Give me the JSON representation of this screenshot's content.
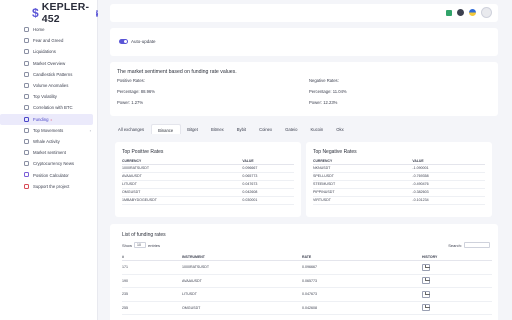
{
  "brand": {
    "name": "KEPLER-452",
    "colors": {
      "accent": "#5a55d6",
      "background": "#f4f5f9",
      "negative": "#e24b6a"
    }
  },
  "sidebar": {
    "items": [
      {
        "label": "Home",
        "icon": "home-icon"
      },
      {
        "label": "Fear and Greed",
        "icon": "gauge-icon"
      },
      {
        "label": "Liquidations",
        "icon": "drop-icon"
      },
      {
        "label": "Market Overview",
        "icon": "chart-icon"
      },
      {
        "label": "Candlestick Patterns",
        "icon": "candle-icon"
      },
      {
        "label": "Volume Anomalies",
        "icon": "wave-icon"
      },
      {
        "label": "Top Volatility",
        "icon": "target-icon"
      },
      {
        "label": "Correlation with BTC",
        "icon": "link-icon"
      },
      {
        "label": "Funding",
        "icon": "calendar-icon",
        "active": true,
        "badge": "•"
      },
      {
        "label": "Top Movements",
        "icon": "trend-icon",
        "arrow": "›"
      },
      {
        "label": "Whale Activity",
        "icon": "whale-icon"
      },
      {
        "label": "Market sentiment",
        "icon": "smile-icon"
      },
      {
        "label": "Cryptocurrency News",
        "icon": "news-icon"
      },
      {
        "label": "Position Calculator",
        "icon": "calculator-icon"
      },
      {
        "label": "Support the project",
        "icon": "heart-icon"
      }
    ]
  },
  "header": {
    "icons": [
      {
        "name": "flag-icon",
        "color": "#31a36a"
      },
      {
        "name": "theme-moon-icon",
        "color": "#3d4150"
      },
      {
        "name": "language-flag-icon",
        "color": "#2f6bd6"
      }
    ],
    "avatar": "avatar"
  },
  "autoupdate": {
    "label": "Auto-update",
    "enabled": true
  },
  "sentiment": {
    "title": "The market sentiment based on funding rate values.",
    "positive": {
      "title": "Positive Rates:",
      "percentage": "Percentage: 88.96%",
      "power": "Power: 1.27%"
    },
    "negative": {
      "title": "Negative Rates:",
      "percentage": "Percentage: 11.04%",
      "power": "Power: 12.23%"
    }
  },
  "tabs": [
    "All exchanges",
    "Binance",
    "Bitget",
    "Bitmex",
    "Bybit",
    "Coinex",
    "Gateio",
    "Kucoin",
    "Okx"
  ],
  "active_tab": "Binance",
  "top_positive": {
    "title": "Top Positive Rates",
    "headers": [
      "CURRENCY",
      "VALUE"
    ],
    "rows": [
      [
        "1000RATSUSDT",
        "0.096667"
      ],
      [
        "AVAAIUSDT",
        "0.065773"
      ],
      [
        "LITUSDT",
        "0.047673"
      ],
      [
        "OMGUSDT",
        "0.042608"
      ],
      [
        "1MBABYDOGEUSDT",
        "0.030001"
      ]
    ]
  },
  "top_negative": {
    "title": "Top Negative Rates",
    "headers": [
      "CURRENCY",
      "VALUE"
    ],
    "rows": [
      [
        "NKNUSDT",
        "-1.090001"
      ],
      [
        "SPELLUSDT",
        "-0.769358"
      ],
      [
        "STEEMUSDT",
        "-0.490476"
      ],
      [
        "PIPPINUSDT",
        "-0.382603"
      ],
      [
        "VIRTUSDT",
        "-0.101234"
      ]
    ]
  },
  "list": {
    "title": "List of funding rates",
    "show_label": "Show",
    "show_value": "10",
    "entries_label": "entries",
    "search_label": "Search:",
    "headers": [
      "#",
      "INSTRUMENT",
      "RATE",
      "HISTORY"
    ],
    "rows": [
      [
        "171",
        "1000RATSUSDT",
        "0.096667"
      ],
      [
        "190",
        "AVAAIUSDT",
        "0.065773"
      ],
      [
        "235",
        "LITUSDT",
        "0.047673"
      ],
      [
        "255",
        "OMGUSDT",
        "0.042608"
      ]
    ]
  }
}
